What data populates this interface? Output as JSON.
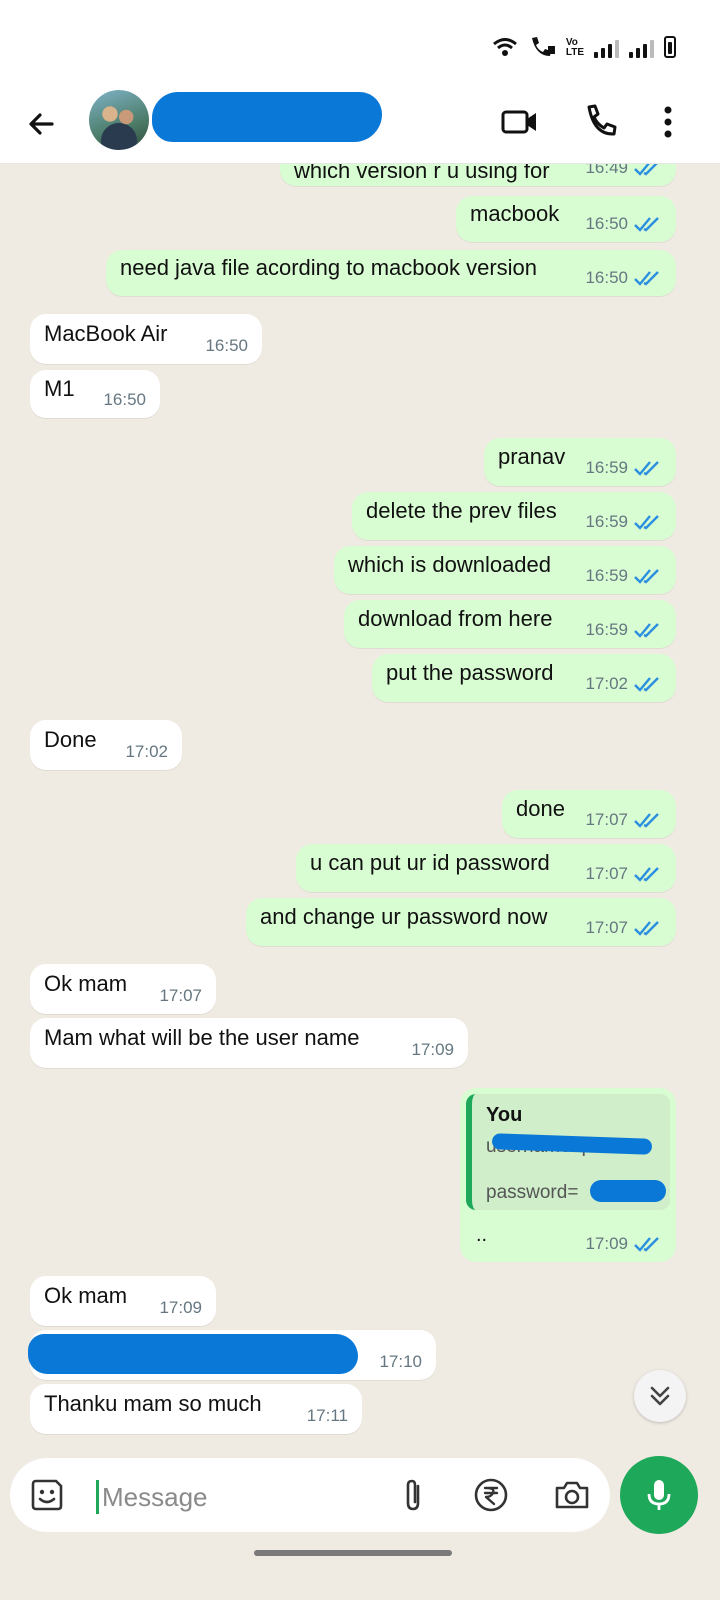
{
  "header": {
    "video_icon": "video-call-icon",
    "call_icon": "phone-icon",
    "more_icon": "more-vertical-icon"
  },
  "messages": [
    {
      "dir": "out",
      "text": "which version r u using for",
      "time": "16:49",
      "ticks": true
    },
    {
      "dir": "out",
      "text": "macbook",
      "time": "16:50",
      "ticks": true
    },
    {
      "dir": "out",
      "text": "need java file acording to macbook version",
      "time": "16:50",
      "ticks": true
    },
    {
      "dir": "in",
      "text": "MacBook Air",
      "time": "16:50"
    },
    {
      "dir": "in",
      "text": "M1",
      "time": "16:50"
    },
    {
      "dir": "out",
      "text": "pranav",
      "time": "16:59",
      "ticks": true
    },
    {
      "dir": "out",
      "text": "delete the prev files",
      "time": "16:59",
      "ticks": true
    },
    {
      "dir": "out",
      "text": "which is downloaded",
      "time": "16:59",
      "ticks": true
    },
    {
      "dir": "out",
      "text": "download from here",
      "time": "16:59",
      "ticks": true
    },
    {
      "dir": "out",
      "text": "put the password",
      "time": "17:02",
      "ticks": true
    },
    {
      "dir": "in",
      "text": "Done",
      "time": "17:02"
    },
    {
      "dir": "out",
      "text": "done",
      "time": "17:07",
      "ticks": true
    },
    {
      "dir": "out",
      "text": "u can put ur id password",
      "time": "17:07",
      "ticks": true
    },
    {
      "dir": "out",
      "text": "and change ur password now",
      "time": "17:07",
      "ticks": true
    },
    {
      "dir": "in",
      "text": "Ok mam",
      "time": "17:07"
    },
    {
      "dir": "in",
      "text": "Mam what will be the user name",
      "time": "17:09"
    }
  ],
  "quoted_reply": {
    "author": "You",
    "line1": "username=pranav",
    "line2": "password=",
    "reply_text": "..",
    "time": "17:09"
  },
  "messages_after": [
    {
      "text": "Ok mam",
      "time": "17:09"
    },
    {
      "text": "",
      "time": "17:10",
      "redacted": true
    },
    {
      "text": "Thanku mam so much",
      "time": "17:11"
    }
  ],
  "composer": {
    "placeholder": "Message",
    "accent": "#1ea85a"
  },
  "colors": {
    "outgoing_bubble": "#d9fdd3",
    "incoming_bubble": "#ffffff",
    "chat_background": "#efeae2",
    "tick_blue": "#2b8fe0",
    "redaction_blue": "#0a78d6"
  }
}
